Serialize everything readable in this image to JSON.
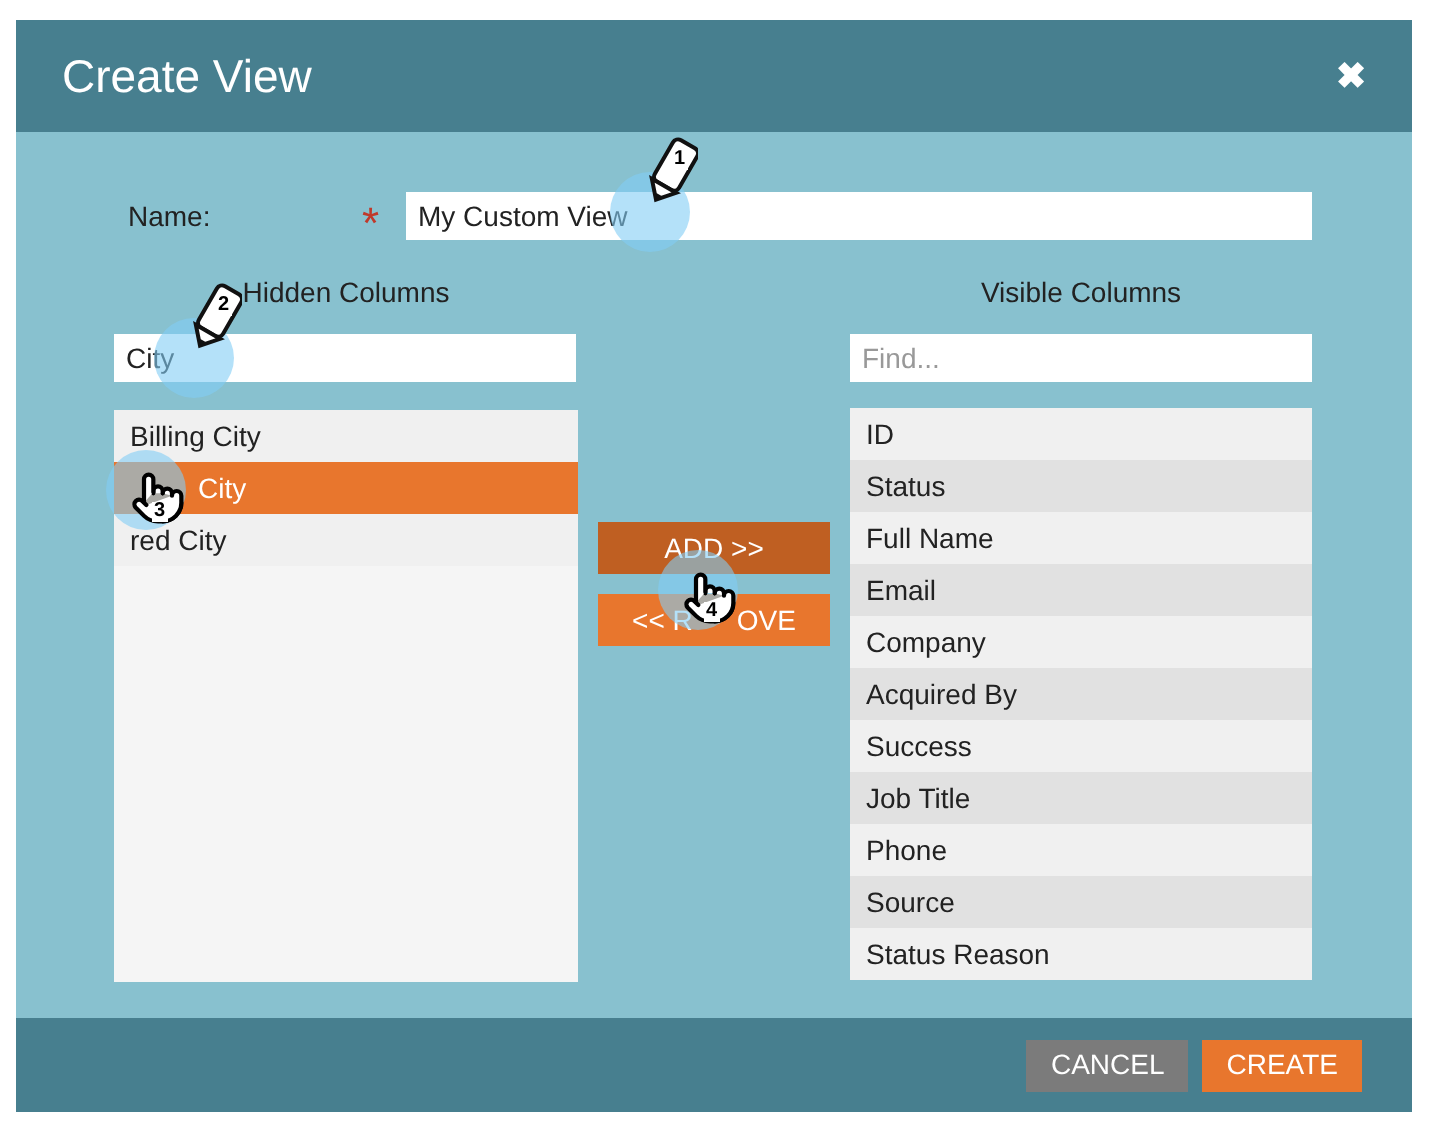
{
  "dialog": {
    "title": "Create View",
    "close": "✖"
  },
  "name_field": {
    "label": "Name:",
    "required_mark": "*",
    "value": "My Custom View",
    "marker": {
      "kind": "pencil",
      "number": "1"
    }
  },
  "hidden_columns": {
    "heading": "Hidden Columns",
    "search": {
      "value": "City",
      "marker": {
        "kind": "pencil",
        "number": "2"
      }
    },
    "items": [
      {
        "label": "Billing City",
        "selected": false
      },
      {
        "label": "City",
        "selected": true,
        "marker": {
          "kind": "hand",
          "number": "3"
        }
      },
      {
        "label": "red City",
        "selected": false
      }
    ]
  },
  "buttons": {
    "add": {
      "label": "ADD >>",
      "pressed": true,
      "marker": {
        "kind": "hand",
        "number": "4"
      }
    },
    "remove": {
      "parts": [
        "<< R",
        "OVE"
      ],
      "pressed": false
    }
  },
  "visible_columns": {
    "heading": "Visible Columns",
    "search": {
      "placeholder": "Find..."
    },
    "items": [
      {
        "label": "ID",
        "selected": false
      },
      {
        "label": "Status",
        "selected": false
      },
      {
        "label": "Full Name",
        "selected": false
      },
      {
        "label": "Email",
        "selected": false
      },
      {
        "label": "Company",
        "selected": false
      },
      {
        "label": "Acquired By",
        "selected": false
      },
      {
        "label": "Success",
        "selected": false
      },
      {
        "label": "Job Title",
        "selected": false
      },
      {
        "label": "Phone",
        "selected": false
      },
      {
        "label": "Source",
        "selected": false
      },
      {
        "label": "Status Reason",
        "selected": false
      }
    ]
  },
  "footer": {
    "buttons": [
      {
        "label": "CANCEL",
        "kind": "secondary"
      },
      {
        "label": "CREATE",
        "kind": "primary"
      }
    ]
  }
}
